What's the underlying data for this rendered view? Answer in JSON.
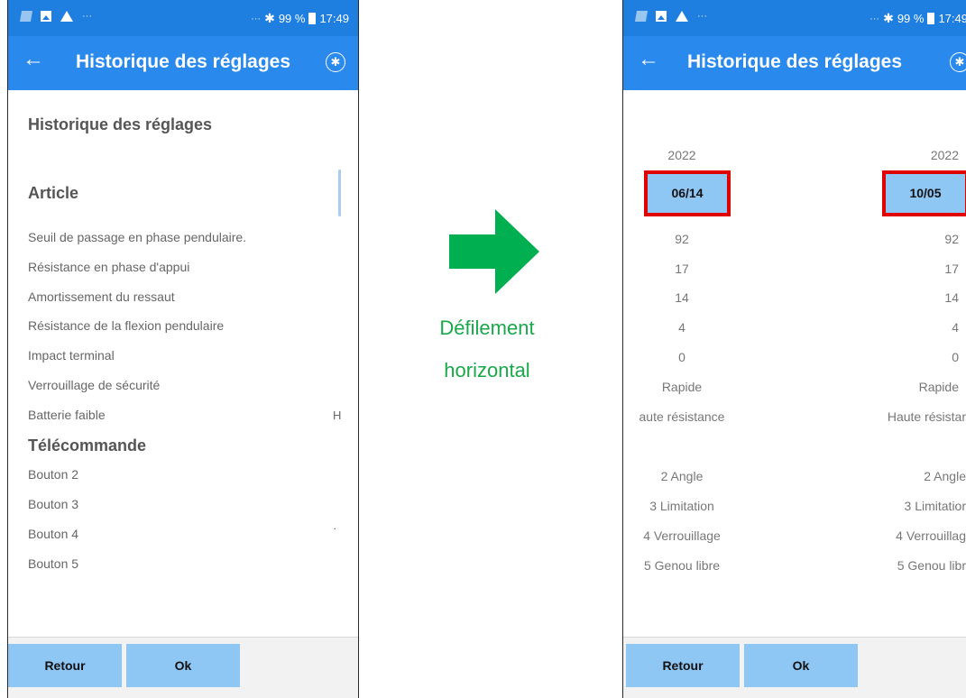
{
  "status_bar": {
    "battery": "99 %",
    "time": "17:49"
  },
  "app_bar": {
    "title": "Historique des réglages"
  },
  "left_screen": {
    "heading": "Historique des réglages",
    "group_article": "Article",
    "article_items": [
      "Seuil de passage en phase pendulaire.",
      "Résistance en phase d'appui",
      "Amortissement du ressaut",
      "Résistance de la flexion pendulaire",
      "Impact terminal",
      "Verrouillage de sécurité",
      "Batterie faible"
    ],
    "battery_edge_text": "H",
    "group_remote": "Télécommande",
    "remote_items": [
      "Bouton 2",
      "Bouton 3",
      "Bouton 4",
      "Bouton 5"
    ],
    "remote_edge_text": "·"
  },
  "right_screen": {
    "columns": [
      {
        "year": "2022",
        "date": "06/14",
        "values": [
          "92",
          "17",
          "14",
          "4",
          "0",
          "Rapide",
          "aute résistance"
        ],
        "remote": [
          "2 Angle",
          "3 Limitation",
          "4 Verrouillage",
          "5 Genou libre"
        ]
      },
      {
        "year": "2022",
        "date": "10/05",
        "values": [
          "92",
          "17",
          "14",
          "4",
          "0",
          "Rapide",
          "Haute résistar"
        ],
        "remote": [
          "2 Angle",
          "3 Limitatior",
          "4 Verrouillag",
          "5 Genou libr"
        ]
      }
    ]
  },
  "buttons": {
    "back": "Retour",
    "ok": "Ok"
  },
  "annotation": {
    "line1": "Défilement",
    "line2": "horizontal",
    "color": "#19a84a"
  },
  "colors": {
    "app_bar": "#2989ec",
    "status_bar": "#1e7fe0",
    "button": "#8ec6f4",
    "highlight_border": "#e00000"
  },
  "icons": [
    "back-arrow-icon",
    "bluetooth-icon",
    "battery-icon",
    "warning-icon",
    "right-arrow-icon"
  ]
}
